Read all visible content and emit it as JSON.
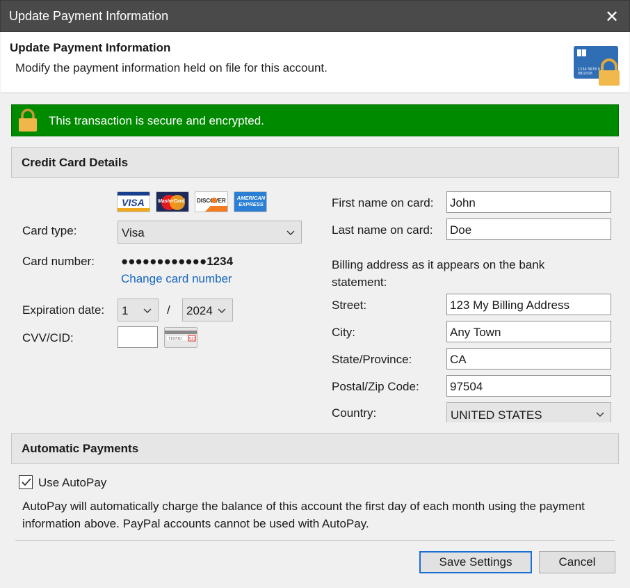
{
  "window": {
    "title": "Update Payment Information",
    "close_glyph": "✕"
  },
  "header": {
    "title": "Update Payment Information",
    "subtitle": "Modify the payment information held on file for this account.",
    "card_number_preview": "1234 5678 9",
    "card_expiry_preview": "08/2016"
  },
  "secure_banner": {
    "text": "This transaction is secure and encrypted.",
    "color": "#008a00"
  },
  "credit_card": {
    "section_title": "Credit Card Details",
    "accepted_cards": [
      {
        "name": "VISA"
      },
      {
        "name": "MasterCard"
      },
      {
        "name": "DISCOVER"
      },
      {
        "name": "AMERICAN EXPRESS"
      }
    ],
    "card_type_label": "Card type:",
    "card_type_value": "Visa",
    "card_number_label": "Card number:",
    "card_number_value": "●●●●●●●●●●●●1234",
    "change_card_link": "Change card number",
    "expiration_label": "Expiration date:",
    "exp_month": "1",
    "exp_separator": "/",
    "exp_year": "2024",
    "cvv_label": "CVV/CID:",
    "cvv_value": "",
    "cvv_hint_digits": "710710",
    "cvv_hint_code": "023"
  },
  "billing": {
    "first_name_label": "First name on card:",
    "first_name": "John",
    "last_name_label": "Last name on card:",
    "last_name": "Doe",
    "address_note": "Billing address as it appears on the bank statement:",
    "street_label": "Street:",
    "street": "123 My Billing Address",
    "city_label": "City:",
    "city": "Any Town",
    "state_label": "State/Province:",
    "state": "CA",
    "zip_label": "Postal/Zip Code:",
    "zip": "97504",
    "country_label": "Country:",
    "country": "UNITED STATES"
  },
  "autopay": {
    "section_title": "Automatic Payments",
    "checkbox_label": "Use AutoPay",
    "checked": true,
    "description": "AutoPay will automatically charge the balance of this account the first day of each month using the payment information above. PayPal accounts cannot be used with AutoPay."
  },
  "buttons": {
    "save": "Save Settings",
    "cancel": "Cancel"
  }
}
